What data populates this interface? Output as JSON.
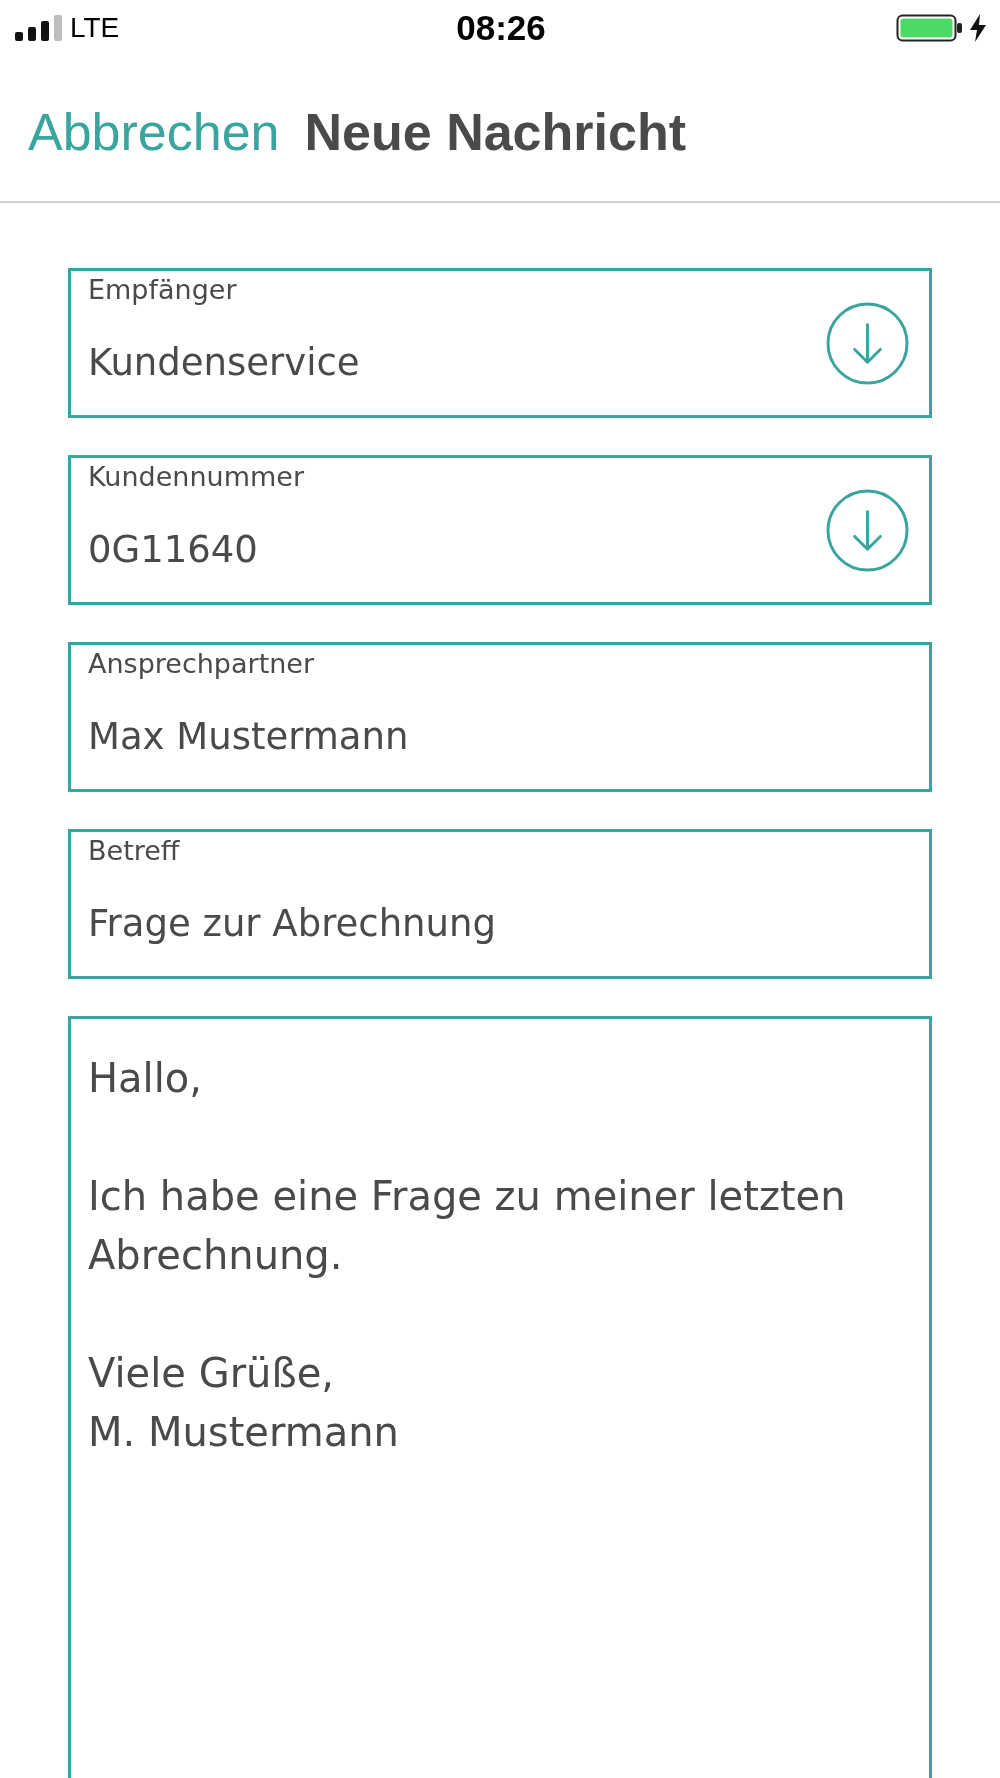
{
  "status_bar": {
    "carrier": "LTE",
    "time": "08:26"
  },
  "header": {
    "cancel": "Abbrechen",
    "title": "Neue Nachricht"
  },
  "fields": [
    {
      "kind": "dropdown",
      "label": "Empfänger",
      "value": "Kundenservice"
    },
    {
      "kind": "dropdown",
      "label": "Kundennummer",
      "value": "0G11640"
    },
    {
      "kind": "text",
      "label": "Ansprechpartner",
      "value": "Max Mustermann"
    },
    {
      "kind": "text",
      "label": "Betreff",
      "value": "Frage zur Abrechnung"
    }
  ],
  "message": {
    "value": "Hallo,\n\nIch habe eine Frage zu meiner letzten Abrechnung.\n\nViele Grüße,\nM. Mustermann"
  }
}
